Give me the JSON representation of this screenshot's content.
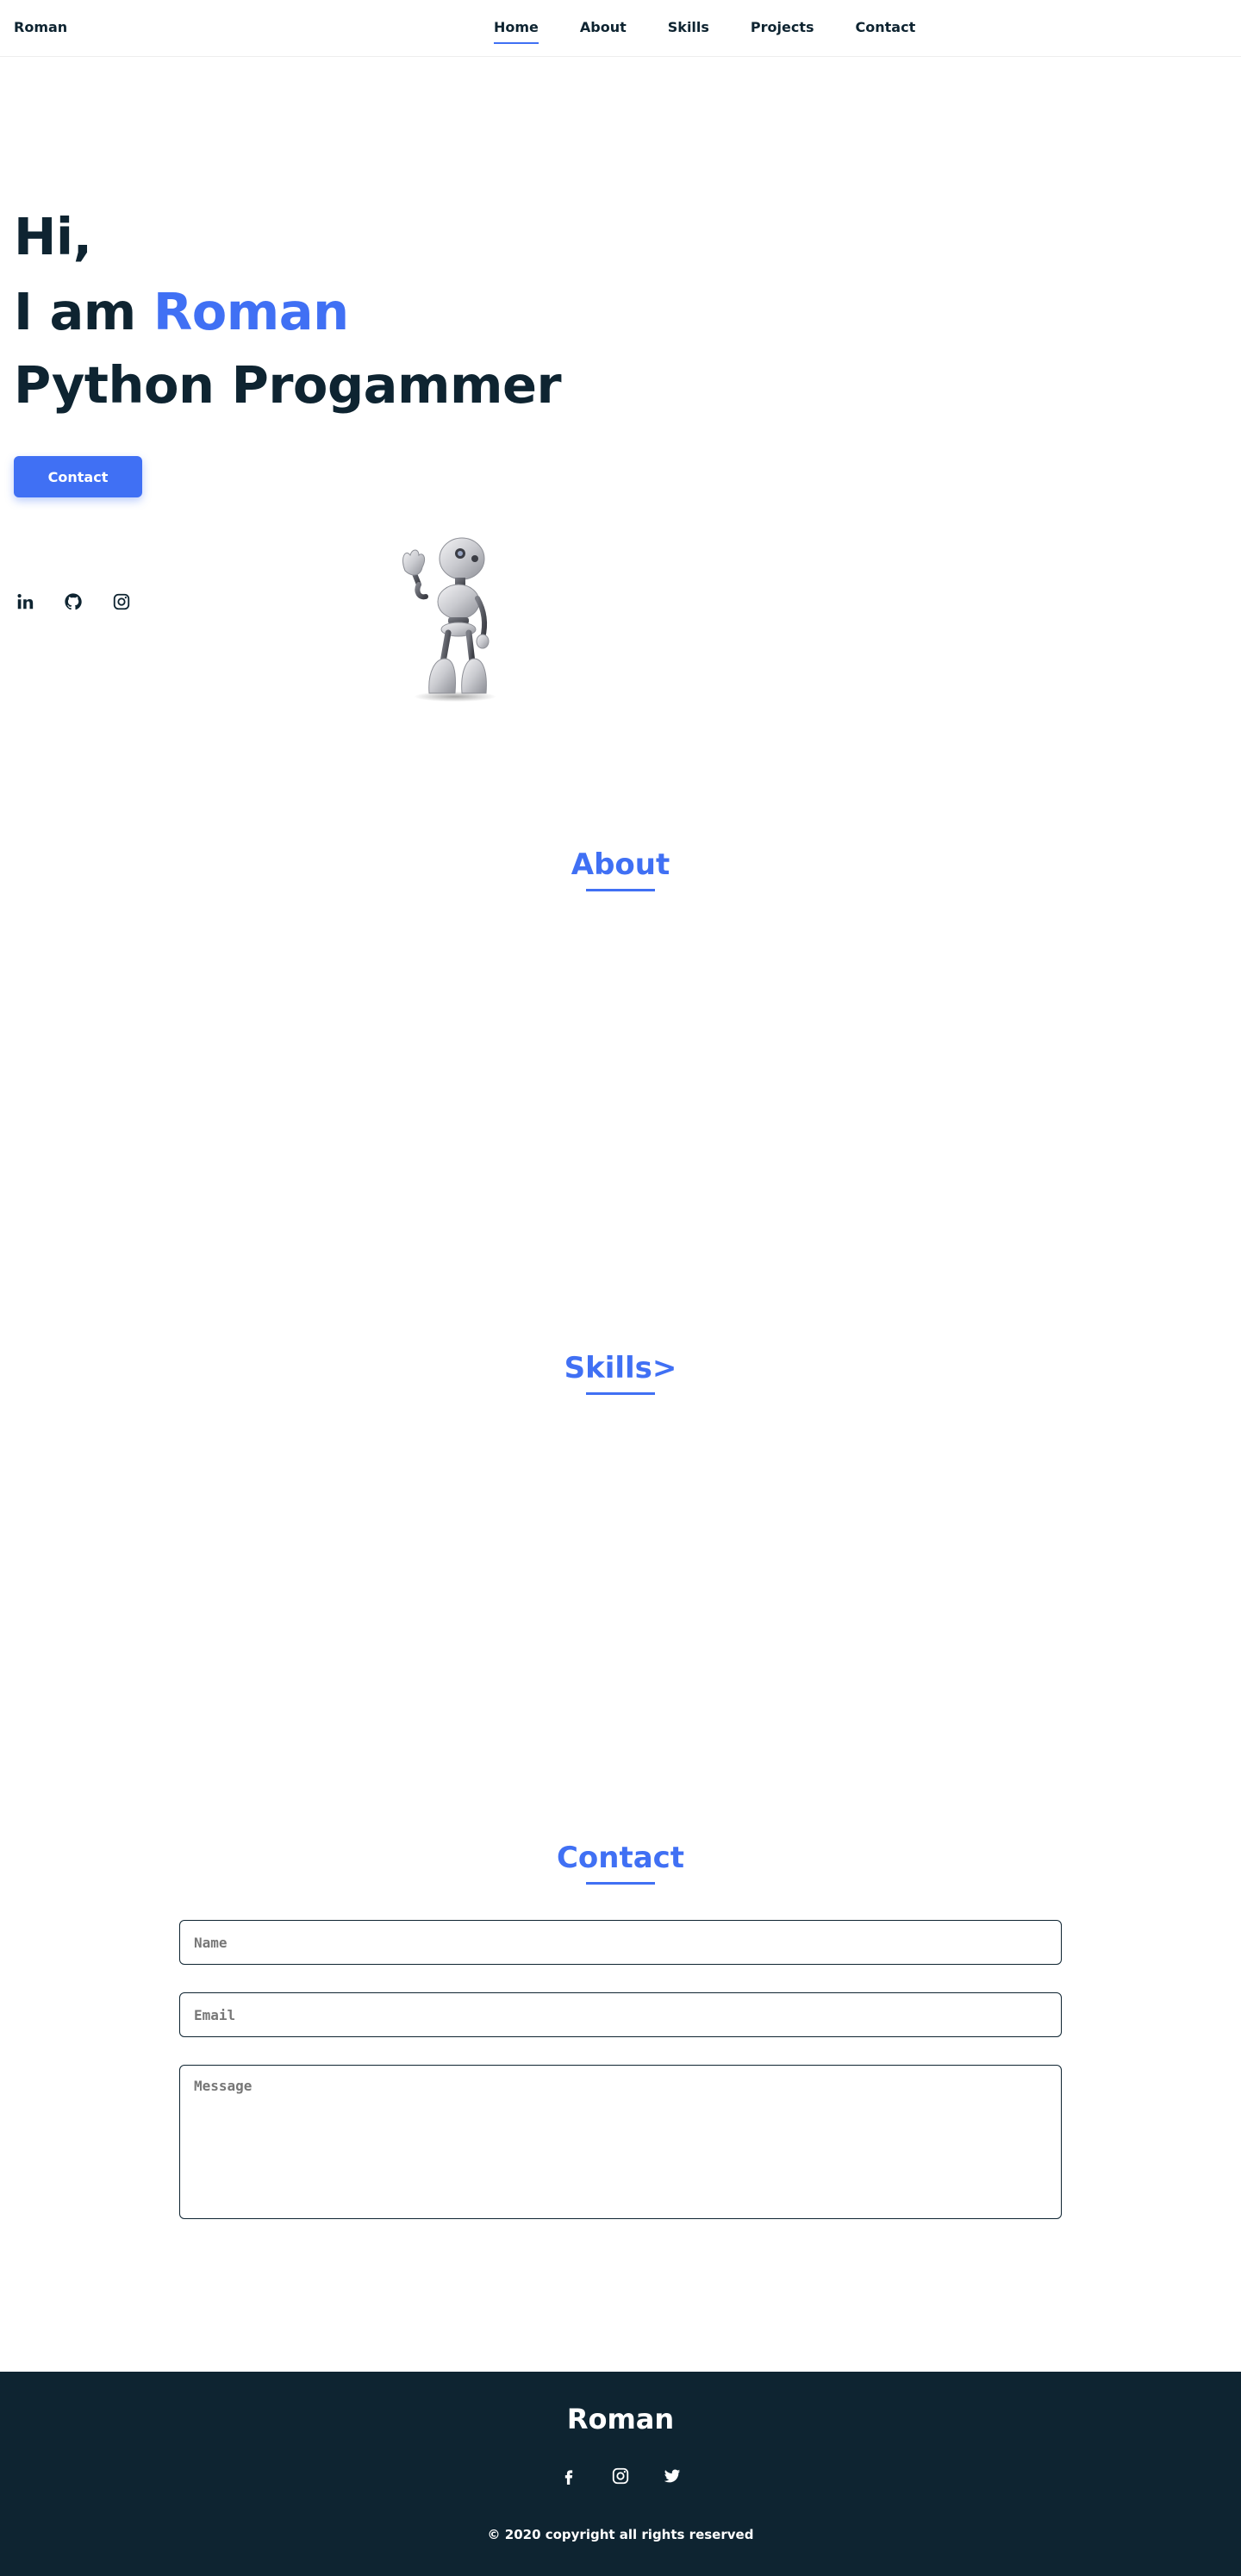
{
  "header": {
    "logo": "Roman",
    "nav": [
      {
        "label": "Home",
        "active": true
      },
      {
        "label": "About",
        "active": false
      },
      {
        "label": "Skills",
        "active": false
      },
      {
        "label": "Projects",
        "active": false
      },
      {
        "label": "Contact",
        "active": false
      }
    ]
  },
  "hero": {
    "line1": "Hi,",
    "line2_prefix": "I am ",
    "line2_name": "Roman",
    "line3": "Python Progammer",
    "button": "Contact",
    "socials": [
      "linkedin-icon",
      "github-icon",
      "instagram-icon"
    ],
    "image": "robot-illustration"
  },
  "sections": {
    "about_title": "About",
    "skills_title": "Skills>",
    "contact_title": "Contact"
  },
  "contact_form": {
    "name_placeholder": "Name",
    "email_placeholder": "Email",
    "message_placeholder": "Message"
  },
  "footer": {
    "title": "Roman",
    "socials": [
      "facebook-icon",
      "instagram-icon",
      "twitter-icon"
    ],
    "copyright": "© 2020 copyright all rights reserved"
  },
  "colors": {
    "accent": "#4070f4",
    "dark": "#0e2431",
    "white": "#ffffff"
  }
}
